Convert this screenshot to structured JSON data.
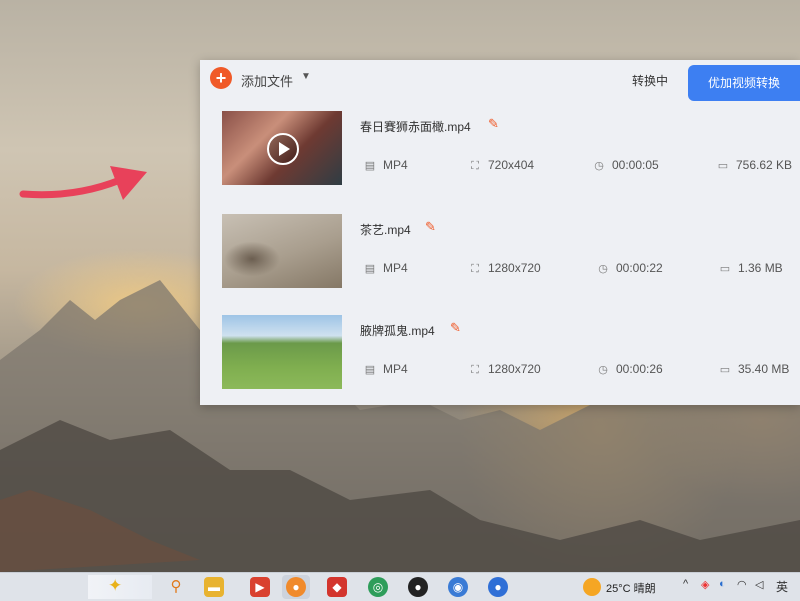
{
  "converter": {
    "add_file_label": "添加文件",
    "status": "转换中",
    "convert_button": "优加视频转换",
    "files": [
      {
        "name": "春日賽狮赤面橄.mp4",
        "format": "MP4",
        "resolution": "720x404",
        "duration": "00:00:05",
        "size": "756.62 KB"
      },
      {
        "name": "茶艺.mp4",
        "format": "MP4",
        "resolution": "1280x720",
        "duration": "00:00:22",
        "size": "1.36 MB"
      },
      {
        "name": "腋牌孤鬼.mp4",
        "format": "MP4",
        "resolution": "1280x720",
        "duration": "00:00:26",
        "size": "35.40 MB"
      }
    ]
  },
  "taskbar": {
    "temperature": "25°C",
    "weather": "晴朗",
    "ime": "英",
    "apps": [
      "search",
      "file-explorer",
      "video-app",
      "firefox",
      "red-app",
      "green-app",
      "qq",
      "browser-blue",
      "recorder"
    ]
  },
  "colors": {
    "accent": "#3d7ff2",
    "add_button": "#f05a28",
    "panel_bg": "#eef0f4",
    "arrow": "#e8415a"
  }
}
